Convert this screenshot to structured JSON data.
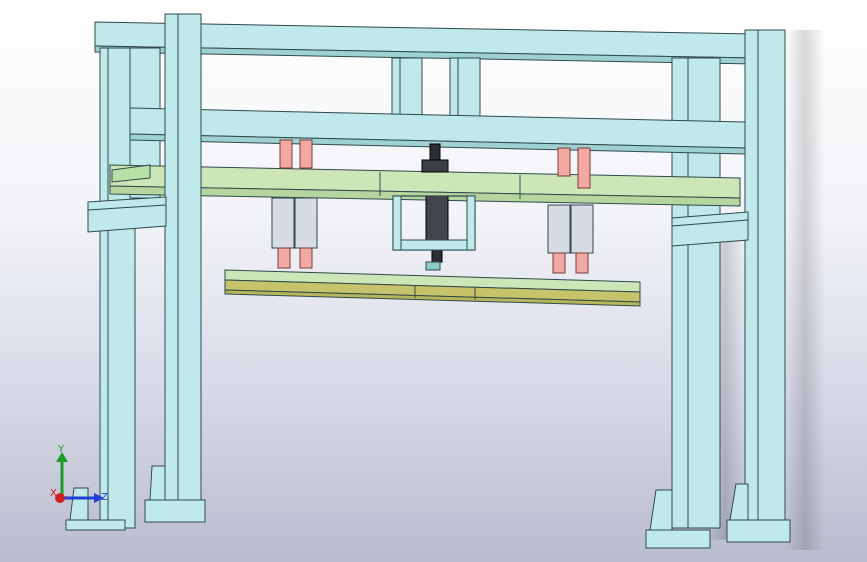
{
  "viewport": {
    "background_top": "#ffffff",
    "background_bottom": "#b9bccd"
  },
  "colors": {
    "frame_fill": "#bfe9ea",
    "frame_stroke": "#2f4a4c",
    "plate_fill": "#cde6b8",
    "plate_edge": "#b9b65a",
    "guide_rod": "#f2a9a3",
    "cylinder_fill": "#d7dbe3",
    "actuator_dark": "#2b2f33"
  },
  "triad": {
    "x_label": "X",
    "y_label": "Y",
    "z_label": "Z",
    "x_color": "#d02020",
    "y_color": "#1f9a2a",
    "z_color": "#1f3fd8"
  }
}
